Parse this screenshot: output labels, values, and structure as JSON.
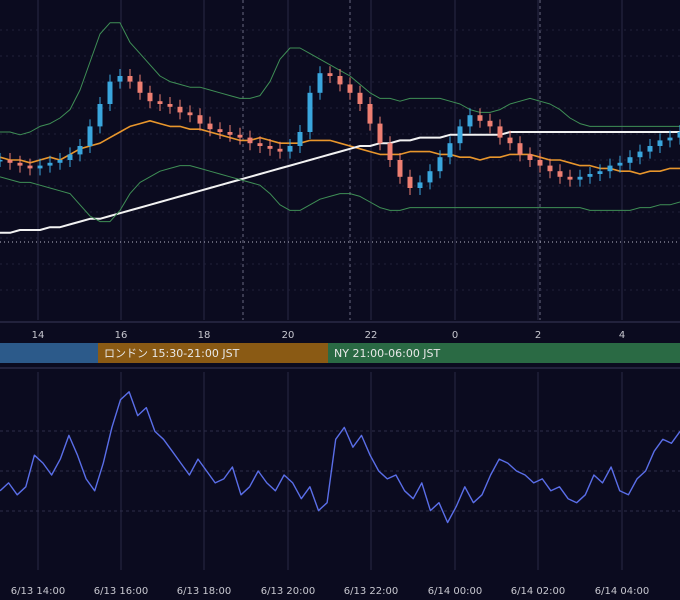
{
  "chart_data": [
    {
      "type": "candlestick",
      "title": "",
      "x_ticks": [
        "14",
        "16",
        "18",
        "20",
        "22",
        "0",
        "2",
        "4"
      ],
      "ylim": [
        0,
        100
      ],
      "grid": true,
      "session_bands": [
        {
          "label": "",
          "color": "#2c5a8a"
        },
        {
          "label": "ロンドン 15:30-21:00 JST",
          "color": "#8a5a14"
        },
        {
          "label": "NY 21:00-06:00 JST",
          "color": "#2a6a44"
        }
      ],
      "series": [
        {
          "kind": "ma_short",
          "color": "#e8962c",
          "values": [
            51,
            50,
            50,
            49,
            50,
            51,
            50,
            52,
            54,
            55,
            56,
            58,
            60,
            62,
            63,
            64,
            63,
            62,
            62,
            61,
            61,
            60,
            59,
            58,
            57,
            57,
            58,
            57,
            56,
            56,
            56,
            57,
            57,
            57,
            56,
            55,
            54,
            53,
            52,
            52,
            52,
            53,
            53,
            53,
            52,
            52,
            51,
            51,
            50,
            51,
            51,
            52,
            52,
            52,
            51,
            50,
            50,
            49,
            48,
            48,
            47,
            47,
            46,
            46,
            45,
            46,
            46,
            47,
            47
          ]
        },
        {
          "kind": "ma_long",
          "color": "#f2f2f2",
          "values": [
            24,
            24,
            25,
            25,
            25,
            26,
            26,
            27,
            28,
            29,
            29,
            30,
            31,
            32,
            33,
            34,
            35,
            36,
            37,
            38,
            39,
            40,
            41,
            42,
            43,
            44,
            45,
            46,
            47,
            48,
            49,
            50,
            51,
            52,
            53,
            54,
            55,
            55,
            56,
            56,
            57,
            57,
            58,
            58,
            58,
            59,
            59,
            59,
            59,
            59,
            59,
            60,
            60,
            60,
            60,
            60,
            60,
            60,
            60,
            60,
            60,
            60,
            60,
            60,
            60,
            60,
            60,
            60,
            60
          ]
        },
        {
          "kind": "bb_upper",
          "color": "#3f8f56",
          "values": [
            60,
            60,
            59,
            60,
            62,
            63,
            65,
            68,
            75,
            85,
            95,
            99,
            99,
            92,
            88,
            84,
            80,
            78,
            77,
            76,
            76,
            75,
            74,
            73,
            72,
            72,
            73,
            78,
            86,
            90,
            90,
            88,
            86,
            84,
            82,
            80,
            77,
            74,
            72,
            72,
            71,
            72,
            72,
            72,
            72,
            71,
            70,
            68,
            67,
            67,
            68,
            70,
            71,
            72,
            71,
            70,
            68,
            65,
            63,
            62,
            62,
            62,
            62,
            62,
            62,
            62,
            62,
            62,
            62
          ]
        },
        {
          "kind": "bb_lower",
          "color": "#3f8f56",
          "values": [
            44,
            43,
            42,
            42,
            41,
            40,
            39,
            38,
            34,
            30,
            28,
            28,
            32,
            38,
            42,
            44,
            46,
            47,
            48,
            48,
            47,
            46,
            45,
            44,
            43,
            42,
            41,
            38,
            34,
            32,
            32,
            34,
            36,
            37,
            38,
            38,
            37,
            35,
            33,
            32,
            32,
            33,
            33,
            33,
            33,
            33,
            33,
            33,
            33,
            33,
            33,
            33,
            33,
            33,
            33,
            33,
            33,
            33,
            33,
            32,
            32,
            32,
            32,
            32,
            33,
            33,
            34,
            34,
            35
          ]
        },
        {
          "kind": "price",
          "values": [
            50,
            49,
            48,
            47,
            48,
            49,
            50,
            52,
            55,
            62,
            70,
            78,
            80,
            78,
            74,
            71,
            70,
            69,
            67,
            66,
            63,
            61,
            60,
            59,
            58,
            56,
            55,
            54,
            53,
            55,
            60,
            74,
            81,
            80,
            77,
            74,
            70,
            63,
            56,
            50,
            44,
            40,
            42,
            46,
            51,
            56,
            62,
            66,
            64,
            62,
            58,
            56,
            52,
            50,
            48,
            46,
            44,
            43,
            44,
            45,
            46,
            48,
            49,
            51,
            53,
            55,
            57,
            58,
            60
          ]
        }
      ]
    },
    {
      "type": "line",
      "title": "",
      "ylim": [
        0,
        100
      ],
      "grid": true,
      "x_ticks": [
        "6/13 14:00",
        "6/13 16:00",
        "6/13 18:00",
        "6/13 20:00",
        "6/13 22:00",
        "6/14 00:00",
        "6/14 02:00",
        "6/14 04:00"
      ],
      "series": [
        {
          "kind": "oscillator",
          "color": "#5a6ee8",
          "values": [
            40,
            44,
            38,
            42,
            58,
            54,
            48,
            56,
            68,
            58,
            46,
            40,
            54,
            72,
            86,
            90,
            78,
            82,
            70,
            66,
            60,
            54,
            48,
            56,
            50,
            44,
            46,
            52,
            38,
            42,
            50,
            44,
            40,
            48,
            44,
            36,
            42,
            30,
            34,
            66,
            72,
            62,
            68,
            58,
            50,
            46,
            48,
            40,
            36,
            44,
            30,
            34,
            24,
            32,
            42,
            34,
            38,
            48,
            56,
            54,
            50,
            48,
            44,
            46,
            40,
            42,
            36,
            34,
            38,
            48,
            44,
            52,
            40,
            38,
            46,
            50,
            60,
            66,
            64,
            70
          ]
        }
      ]
    }
  ]
}
